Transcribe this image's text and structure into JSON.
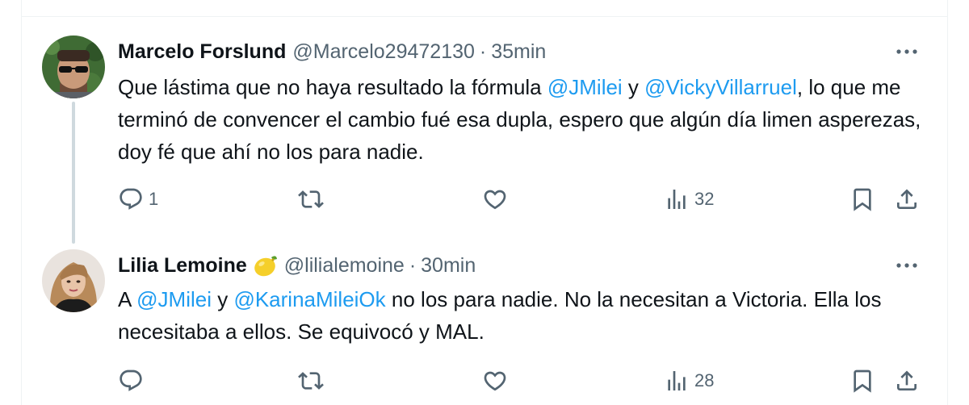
{
  "tweets": [
    {
      "name": "Marcelo Forslund",
      "handle": "@Marcelo29472130",
      "separator": "·",
      "time": "35min",
      "text": {
        "p1": "Que lástima que no haya resultado la fórmula ",
        "m1": "@JMilei",
        "p2": " y ",
        "m2": "@VickyVillarruel",
        "p3": ", lo que me terminó de convencer el cambio  fué esa dupla, espero que algún día limen asperezas, doy fé que ahí no los para nadie."
      },
      "replies": "1",
      "views": "32"
    },
    {
      "name": "Lilia Lemoine",
      "emoji": "lemon",
      "handle": "@lilialemoine",
      "separator": "·",
      "time": "30min",
      "text": {
        "p1": "A ",
        "m1": "@JMilei",
        "p2": " y ",
        "m2": "@KarinaMileiOk",
        "p3": " no los para nadie. No la necesitan a Victoria. Ella los necesitaba a ellos. Se equivocó y MAL."
      },
      "replies": "",
      "views": "28"
    }
  ],
  "icons": {
    "more": "more-horizontal-icon",
    "reply": "reply-icon",
    "retweet": "retweet-icon",
    "like": "heart-icon",
    "views": "views-icon",
    "bookmark": "bookmark-icon",
    "share": "share-icon"
  },
  "colors": {
    "text": "#0f1419",
    "secondary": "#536471",
    "mention": "#1d9bf0",
    "thread_line": "#cfd9de"
  }
}
